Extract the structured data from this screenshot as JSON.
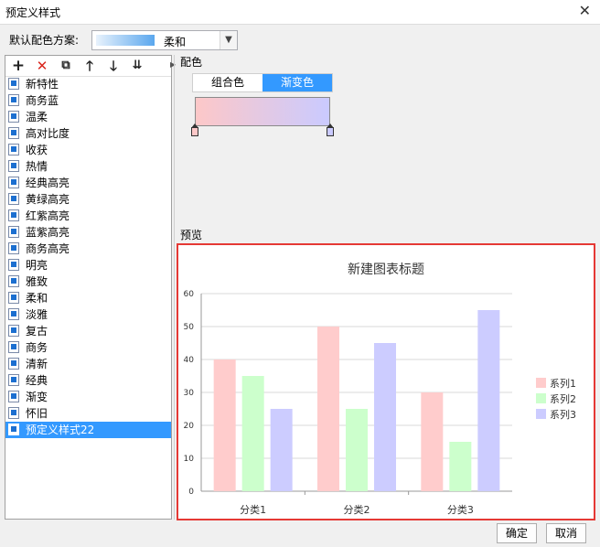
{
  "window": {
    "title": "预定义样式"
  },
  "scheme": {
    "label": "默认配色方案:",
    "value": "柔和"
  },
  "toolbar": {
    "add": "+",
    "delete": "✕",
    "copy": "⧉",
    "up": "🡑",
    "down": "🡓",
    "sort": "⇊"
  },
  "styles": [
    "新特性",
    "商务蓝",
    "温柔",
    "高对比度",
    "收获",
    "热情",
    "经典高亮",
    "黄绿高亮",
    "红紫高亮",
    "蓝紫高亮",
    "商务高亮",
    "明亮",
    "雅致",
    "柔和",
    "淡雅",
    "复古",
    "商务",
    "清新",
    "经典",
    "渐变",
    "怀旧",
    "预定义样式22"
  ],
  "selected_style": "预定义样式22",
  "color_section": {
    "label": "配色",
    "tabs": [
      "组合色",
      "渐变色"
    ],
    "active_tab": "渐变色",
    "gradient_start": "#fdc8c8",
    "gradient_end": "#cacaff"
  },
  "preview_label": "预览",
  "chart_data": {
    "type": "bar",
    "title": "新建图表标题",
    "categories": [
      "分类1",
      "分类2",
      "分类3"
    ],
    "series": [
      {
        "name": "系列1",
        "values": [
          40,
          50,
          30
        ],
        "color": "#ffcccc"
      },
      {
        "name": "系列2",
        "values": [
          35,
          25,
          15
        ],
        "color": "#ccffcc"
      },
      {
        "name": "系列3",
        "values": [
          25,
          45,
          55
        ],
        "color": "#ccccff"
      }
    ],
    "ylim": [
      0,
      60
    ],
    "yticks": [
      0,
      10,
      20,
      30,
      40,
      50,
      60
    ],
    "grid": true,
    "legend": "right"
  },
  "buttons": {
    "ok": "确定",
    "cancel": "取消"
  }
}
